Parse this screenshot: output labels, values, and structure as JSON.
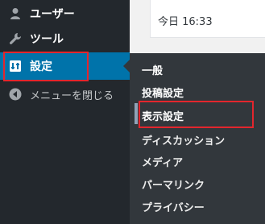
{
  "sidebar": {
    "items": [
      {
        "label": "ユーザー",
        "icon": "user-icon"
      },
      {
        "label": "ツール",
        "icon": "wrench-icon"
      },
      {
        "label": "設定",
        "icon": "settings-icon",
        "active": true
      },
      {
        "label": "メニューを閉じる",
        "icon": "collapse-arrow-icon"
      }
    ]
  },
  "dashboard": {
    "date_text": "今日 16:33"
  },
  "submenu": {
    "items": [
      {
        "label": "一般"
      },
      {
        "label": "投稿設定"
      },
      {
        "label": "表示設定",
        "highlighted": true
      },
      {
        "label": "ディスカッション"
      },
      {
        "label": "メディア"
      },
      {
        "label": "パーマリンク"
      },
      {
        "label": "プライバシー"
      }
    ]
  },
  "colors": {
    "sidebar_bg": "#23282d",
    "submenu_bg": "#32373c",
    "active_bg": "#0073aa",
    "highlight_border": "#e3262d"
  }
}
